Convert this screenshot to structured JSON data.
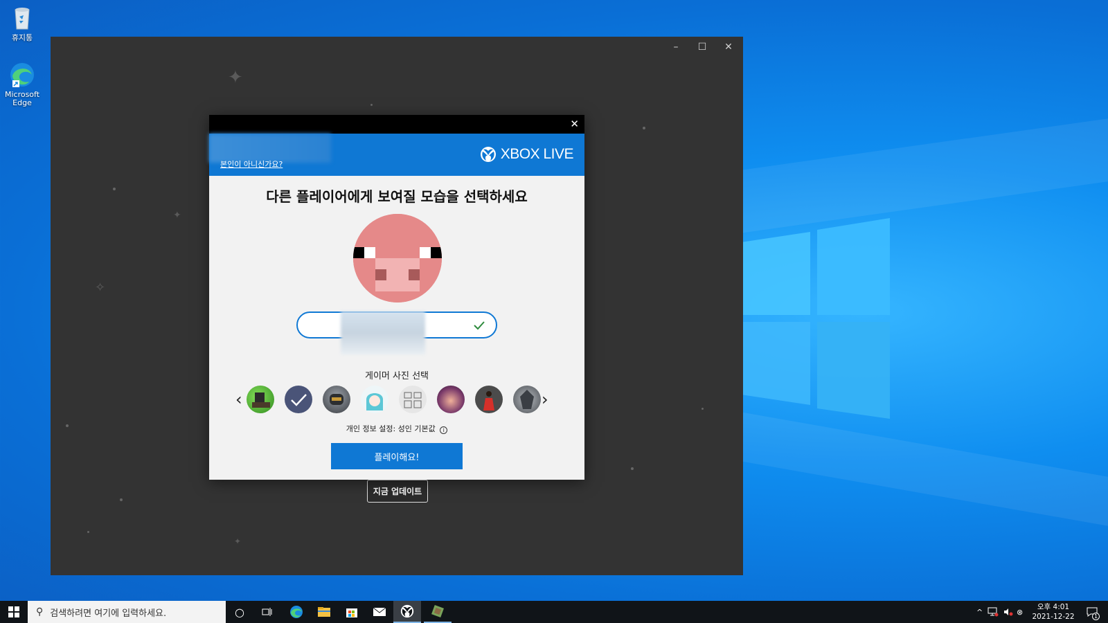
{
  "desktop": {
    "icons": [
      {
        "label": "휴지통",
        "icon": "recycle-bin-icon"
      },
      {
        "label": "Microsoft Edge",
        "icon": "edge-icon"
      }
    ]
  },
  "window": {
    "controls": {
      "minimize": "–",
      "maximize": "☐",
      "close": "✕"
    },
    "update_button": "지금 업데이트"
  },
  "dialog": {
    "close": "✕",
    "banner_link": "본인이 아니신가요?",
    "brand": "XBOX LIVE",
    "title": "다른 플레이어에게 보여질 모습을 선택하세요",
    "gamerpic_label": "게이머 사진 선택",
    "gamerpics": [
      "green-adventurer",
      "selected-check",
      "spartan-helmet",
      "anime-girl",
      "robot-sketch",
      "purple-creature",
      "red-dress-character",
      "mech-robot"
    ],
    "privacy_text": "개인 정보 설정: 성인 기본값",
    "play_button": "플레이해요!",
    "accent": "#0f78d4"
  },
  "taskbar": {
    "search_placeholder": "검색하려면 여기에 입력하세요.",
    "apps": [
      "cortana-icon",
      "task-view-icon",
      "edge-icon",
      "file-explorer-icon",
      "store-icon",
      "mail-icon",
      "xbox-icon",
      "minecraft-icon"
    ],
    "clock": {
      "time": "오후 4:01",
      "date": "2021-12-22"
    },
    "notification_count": "1"
  }
}
